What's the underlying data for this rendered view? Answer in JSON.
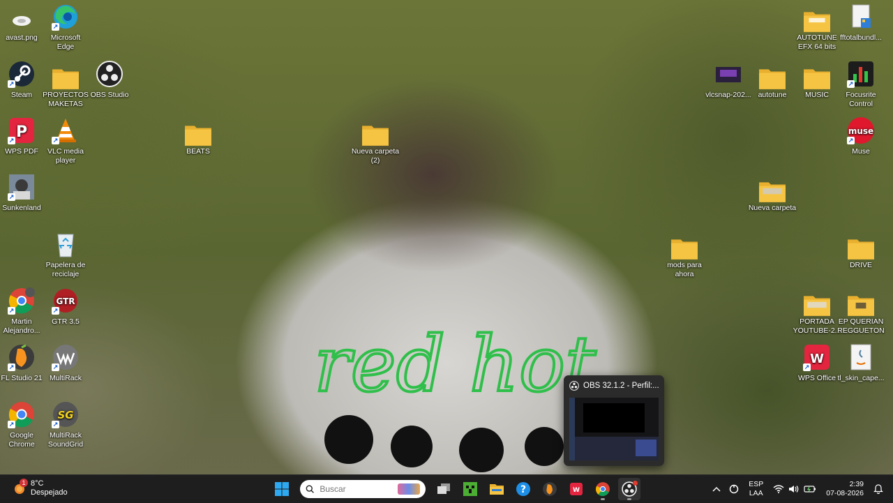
{
  "desktop": {
    "icons": [
      {
        "id": "avast",
        "label": "avast.png"
      },
      {
        "id": "edge",
        "label": "Microsoft Edge"
      },
      {
        "id": "steam",
        "label": "Steam"
      },
      {
        "id": "proyectos",
        "label": "PROYECTOS MAKETAS"
      },
      {
        "id": "obs",
        "label": "OBS Studio"
      },
      {
        "id": "wpspdf",
        "label": "WPS PDF"
      },
      {
        "id": "vlc",
        "label": "VLC media player"
      },
      {
        "id": "beats",
        "label": "BEATS"
      },
      {
        "id": "nuevacarpeta2",
        "label": "Nueva carpeta (2)"
      },
      {
        "id": "sunkenland",
        "label": "Sunkenland"
      },
      {
        "id": "papelera",
        "label": "Papelera de reciclaje"
      },
      {
        "id": "martin",
        "label": "Martin Alejandro..."
      },
      {
        "id": "gtr",
        "label": "GTR 3.5"
      },
      {
        "id": "flstudio",
        "label": "FL Studio 21"
      },
      {
        "id": "multirack",
        "label": "MultiRack"
      },
      {
        "id": "chrome",
        "label": "Google Chrome"
      },
      {
        "id": "multiracksg",
        "label": "MultiRack SoundGrid"
      },
      {
        "id": "autotuneefx",
        "label": "AUTOTUNE EFX 64 bits"
      },
      {
        "id": "fftotal",
        "label": "fftotalbundl..."
      },
      {
        "id": "vlcsnap",
        "label": "vlcsnap-202..."
      },
      {
        "id": "autotune",
        "label": "autotune"
      },
      {
        "id": "music",
        "label": "MUSIC"
      },
      {
        "id": "focusrite",
        "label": "Focusrite Control"
      },
      {
        "id": "muse",
        "label": "Muse"
      },
      {
        "id": "nuevacarpeta",
        "label": "Nueva carpeta"
      },
      {
        "id": "mods",
        "label": "mods para ahora"
      },
      {
        "id": "drive",
        "label": "DRIVE"
      },
      {
        "id": "portada",
        "label": "PORTADA YOUTUBE-2..."
      },
      {
        "id": "epquerian",
        "label": "EP QUERIAN REGGUETON"
      },
      {
        "id": "wpsoffice",
        "label": "WPS Office"
      },
      {
        "id": "tlskin",
        "label": "tl_skin_cape..."
      }
    ]
  },
  "taskbar": {
    "weather": {
      "temp": "8°C",
      "condition": "Despejado",
      "badge": "1"
    },
    "search": {
      "placeholder": "Buscar"
    },
    "tray": {
      "lang_top": "ESP",
      "lang_bottom": "LAA",
      "time": "2:39",
      "date": "07-08-2026"
    }
  },
  "preview": {
    "title": "OBS 32.1.2 - Perfil:..."
  },
  "colors": {
    "folder": "#f6c443",
    "taskbar": "#1e1e1e",
    "accent": "#0078d4"
  }
}
